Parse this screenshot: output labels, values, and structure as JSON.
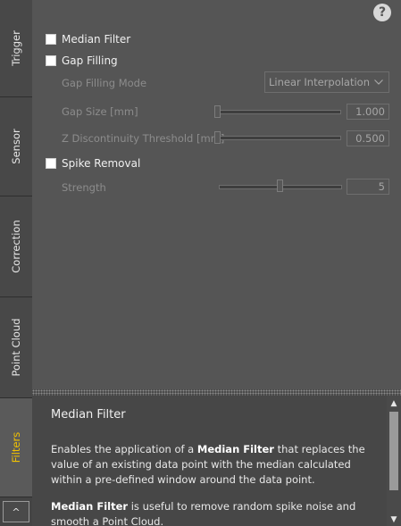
{
  "sidebar": {
    "tabs": [
      {
        "label": "Trigger"
      },
      {
        "label": "Sensor"
      },
      {
        "label": "Correction"
      },
      {
        "label": "Point Cloud"
      },
      {
        "label": "Filters",
        "active": true
      }
    ],
    "collapse_label": "^"
  },
  "help_glyph": "?",
  "filters": {
    "median": {
      "label": "Median Filter",
      "checked": false
    },
    "gap": {
      "label": "Gap Filling",
      "checked": false
    },
    "gap_mode": {
      "label": "Gap Filling Mode",
      "value": "Linear Interpolation"
    },
    "gap_size": {
      "label": "Gap Size [mm]",
      "value": "1.000"
    },
    "z_disc": {
      "label": "Z Discontinuity Threshold [mm]",
      "value": "0.500"
    },
    "spike": {
      "label": "Spike Removal",
      "checked": false
    },
    "strength": {
      "label": "Strength",
      "value": "5"
    }
  },
  "description": {
    "title": "Median Filter",
    "p1_pre": "Enables the application of a ",
    "p1_bold": "Median Filter",
    "p1_post": " that replaces the value of an existing data point with the median calculated within a pre-defined window around the data point.",
    "p2_bold": "Median Filter",
    "p2_post": " is useful to remove random spike noise and smooth a Point Cloud."
  },
  "colors": {
    "active_tab": "#f2c200",
    "background": "#555555"
  }
}
